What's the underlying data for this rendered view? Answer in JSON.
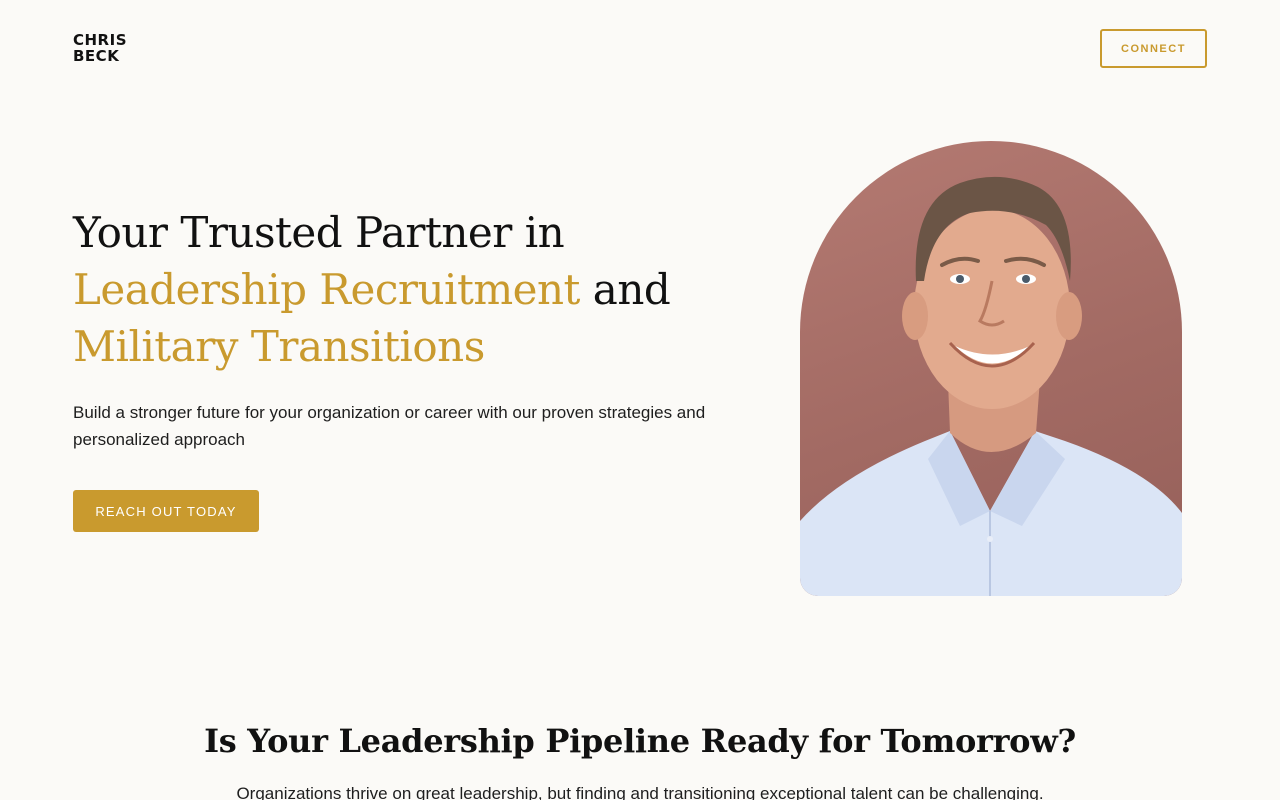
{
  "header": {
    "logo_line1": "CHRIS",
    "logo_line2": "BECK",
    "connect_label": "CONNECT"
  },
  "hero": {
    "title_part1": "Your Trusted Partner in",
    "title_gold1": "Leadership Recruitment",
    "title_and": "and",
    "title_gold2": "Military Transitions",
    "subtitle": "Build a stronger future for your organization or career with our proven strategies and personalized approach",
    "cta_label": "REACH OUT TODAY"
  },
  "section2": {
    "title": "Is Your Leadership Pipeline Ready for Tomorrow?",
    "subtitle": "Organizations thrive on great leadership, but finding and transitioning exceptional talent can be challenging."
  },
  "colors": {
    "accent": "#c99a2e",
    "background": "#fbfaf7",
    "text": "#111111",
    "portrait_bg": "#a86e67"
  }
}
